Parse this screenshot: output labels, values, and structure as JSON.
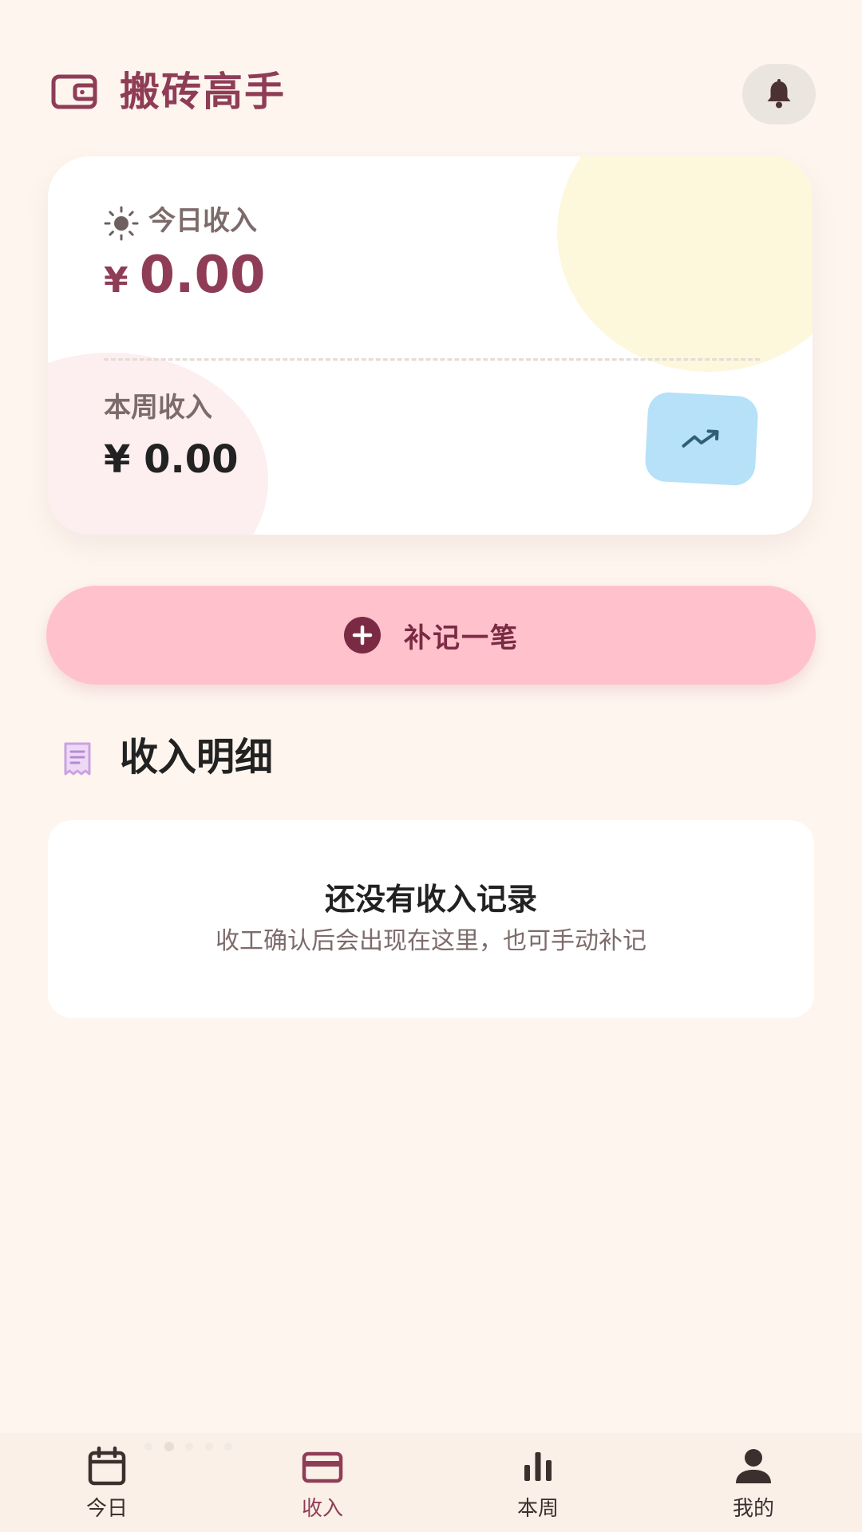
{
  "header": {
    "title": "搬砖高手",
    "icon": "wallet-icon",
    "notification_icon": "bell-icon"
  },
  "summary": {
    "today": {
      "label": "今日收入",
      "currency": "¥",
      "amount": "0.00",
      "icon": "sun-icon"
    },
    "week": {
      "label": "本周收入",
      "amount_text": "¥ 0.00"
    },
    "trend_icon": "trending-up-icon"
  },
  "add_button": {
    "label": "补记一笔",
    "icon": "plus-circle-icon"
  },
  "records": {
    "title": "收入明细",
    "icon": "receipt-icon",
    "empty_title": "还没有收入记录",
    "empty_subtitle": "收工确认后会出现在这里，也可手动补记"
  },
  "pager": {
    "count": 5,
    "active_index": 1
  },
  "nav": {
    "items": [
      {
        "label": "今日",
        "icon": "calendar-icon"
      },
      {
        "label": "收入",
        "icon": "card-icon"
      },
      {
        "label": "本周",
        "icon": "bar-chart-icon"
      },
      {
        "label": "我的",
        "icon": "person-icon"
      }
    ],
    "active_index": 1
  },
  "colors": {
    "background": "#fdf5ee",
    "brand": "#8f3d57",
    "add_button": "#ffc1cb",
    "trend_button": "#b6e1f8",
    "bell_button": "#ebe5e0"
  }
}
